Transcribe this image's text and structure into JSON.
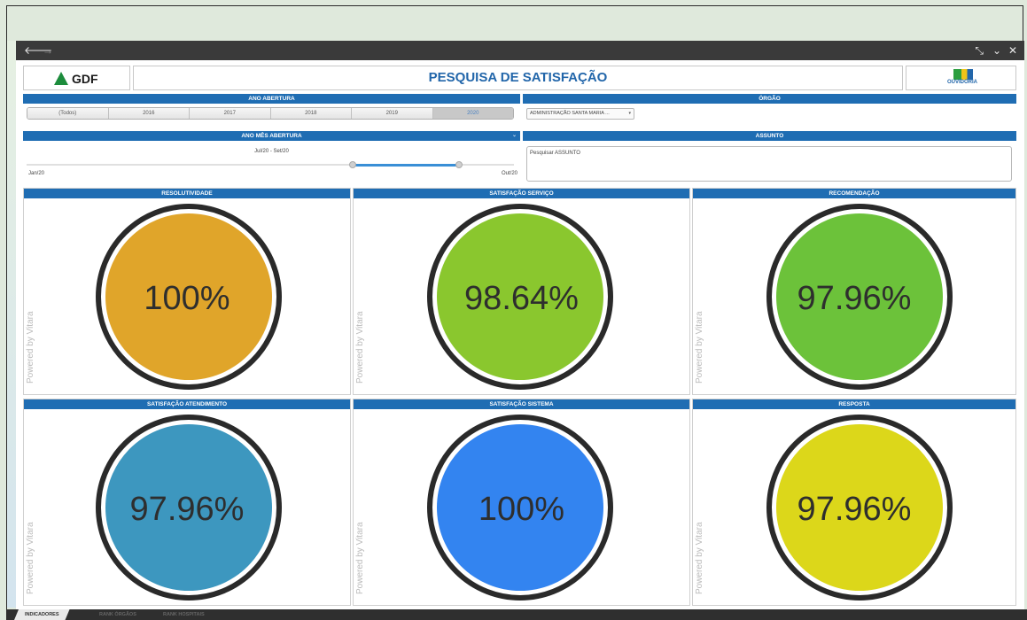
{
  "window": {
    "back_icon": "arrow-left-icon",
    "forward_icon": "arrow-right-icon",
    "controls": [
      "minimize-icon",
      "chevron-down-icon",
      "close-icon"
    ]
  },
  "header": {
    "left_logo_text": "GDF",
    "title": "PESQUISA DE SATISFAÇÃO",
    "right_logo_text": "OUVIDORIA"
  },
  "ano_abertura": {
    "label": "ANO ABERTURA",
    "options": [
      "(Todos)",
      "2016",
      "2017",
      "2018",
      "2019",
      "2020"
    ],
    "selected": "2020"
  },
  "orgao": {
    "label": "ÓRGÃO",
    "selected": "ADMINISTRAÇÃO SANTA MARIA ..."
  },
  "ano_mes": {
    "label": "ANO MÊS ABERTURA",
    "range_label": "Jul/20 - Set/20",
    "min_label": "Jan/20",
    "max_label": "Out/20"
  },
  "assunto": {
    "label": "ASSUNTO",
    "placeholder": "Pesquisar ASSUNTO"
  },
  "gauges": [
    {
      "title": "RESOLUTIVIDADE",
      "value": "100%",
      "color": "#e0a52a"
    },
    {
      "title": "SATISFAÇÃO SERVIÇO",
      "value": "98.64%",
      "color": "#8ac72e"
    },
    {
      "title": "RECOMENDAÇÃO",
      "value": "97.96%",
      "color": "#6cc23a"
    },
    {
      "title": "SATISFAÇÃO ATENDIMENTO",
      "value": "97.96%",
      "color": "#3d97bf"
    },
    {
      "title": "SATISFAÇÃO SISTEMA",
      "value": "100%",
      "color": "#3384f0"
    },
    {
      "title": "RESPOSTA",
      "value": "97.96%",
      "color": "#dcd71a"
    }
  ],
  "powered_by": "Powered by Vitara",
  "tabs": [
    "INDICADORES",
    "RANK ÓRGÃOS",
    "RANK HOSPITAIS"
  ]
}
